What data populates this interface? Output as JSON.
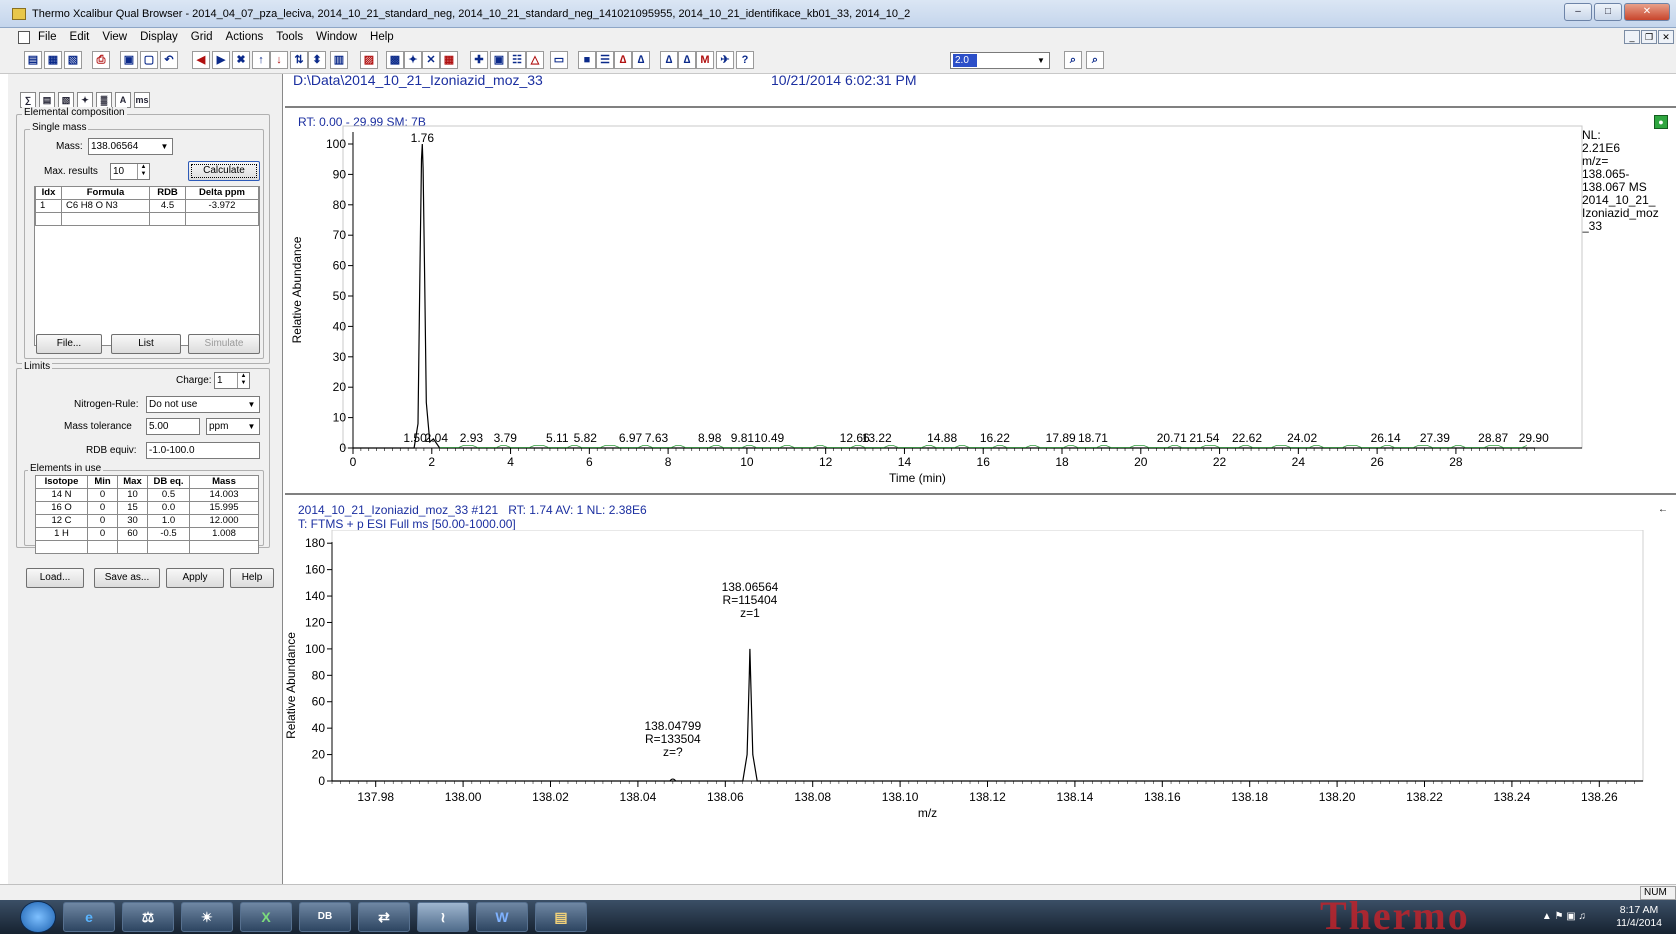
{
  "window": {
    "title": "Thermo Xcalibur Qual Browser - 2014_04_07_pza_leciva, 2014_10_21_standard_neg, 2014_10_21_standard_neg_141021095955, 2014_10_21_identifikace_kb01_33, 2014_10_2"
  },
  "menu": [
    "File",
    "Edit",
    "View",
    "Display",
    "Grid",
    "Actions",
    "Tools",
    "Window",
    "Help"
  ],
  "toolbar": {
    "zoom_value": "2.0"
  },
  "left": {
    "icons": [
      "calc-icon",
      "doc-icon",
      "spectrum-icon",
      "atom-icon",
      "chart-icon",
      "letter-a-icon",
      "ms-icon"
    ],
    "elemental_composition": "Elemental composition",
    "single_mass": "Single mass",
    "mass_label": "Mass:",
    "mass_value": "138.06564",
    "max_results_label": "Max. results",
    "max_results_value": "10",
    "calculate": "Calculate",
    "results_headers": [
      "Idx",
      "Formula",
      "RDB",
      "Delta ppm"
    ],
    "results_rows": [
      [
        "1",
        "C6 H8 O N3",
        "4.5",
        "-3.972"
      ]
    ],
    "file_btn": "File...",
    "list_btn": "List",
    "simulate_btn": "Simulate",
    "limits": "Limits",
    "charge_label": "Charge:",
    "charge_value": "1",
    "nitrogen_label": "Nitrogen-Rule:",
    "nitrogen_value": "Do not use",
    "mass_tol_label": "Mass tolerance",
    "mass_tol_value": "5.00",
    "mass_tol_unit": "ppm",
    "rdb_label": "RDB equiv:",
    "rdb_value": "-1.0-100.0",
    "elements_in_use": "Elements in use",
    "elements_headers": [
      "Isotope",
      "Min",
      "Max",
      "DB eq.",
      "Mass"
    ],
    "elements_rows": [
      [
        "14 N",
        "0",
        "10",
        "0.5",
        "14.003"
      ],
      [
        "16 O",
        "0",
        "15",
        "0.0",
        "15.995"
      ],
      [
        "12 C",
        "0",
        "30",
        "1.0",
        "12.000"
      ],
      [
        "1 H",
        "0",
        "60",
        "-0.5",
        "1.008"
      ]
    ],
    "load_btn": "Load...",
    "saveas_btn": "Save as...",
    "apply_btn": "Apply",
    "help_btn": "Help"
  },
  "header": {
    "path": "D:\\Data\\2014_10_21_Izoniazid_moz_33",
    "datetime": "10/21/2014 6:02:31 PM"
  },
  "chrom": {
    "info": "RT: 0.00 - 29.99   SM: 7B",
    "ylabel": "Relative Abundance",
    "xlabel": "Time (min)",
    "side": [
      "NL:",
      "2.21E6",
      "m/z=",
      "138.065-",
      "138.067  MS",
      "2014_10_21_",
      "Izoniazid_moz",
      "_33"
    ]
  },
  "spec": {
    "info1_name": "2014_10_21_Izoniazid_moz_33 #121",
    "info1_rest": "RT: 1.74   AV: 1   NL: 2.38E6",
    "info2": "T: FTMS + p ESI Full ms [50.00-1000.00]",
    "ylabel": "Relative Abundance",
    "xlabel": "m/z"
  },
  "chart_data": [
    {
      "type": "line",
      "title": "RT: 0.00 - 29.99   SM: 7B",
      "xlabel": "Time (min)",
      "ylabel": "Relative Abundance",
      "xlim": [
        0,
        30
      ],
      "ylim": [
        0,
        100
      ],
      "xticks": [
        0,
        2,
        4,
        6,
        8,
        10,
        12,
        14,
        16,
        18,
        20,
        22,
        24,
        26,
        28
      ],
      "yticks": [
        0,
        10,
        20,
        30,
        40,
        50,
        60,
        70,
        80,
        90,
        100
      ],
      "peak_labels": [
        {
          "x": 1.5,
          "label": "1.50"
        },
        {
          "x": 1.76,
          "label": "1.76",
          "y": 100
        },
        {
          "x": 2.04,
          "label": "2.04"
        },
        {
          "x": 2.93,
          "label": "2.93"
        },
        {
          "x": 3.79,
          "label": "3.79"
        },
        {
          "x": 5.11,
          "label": "5.11"
        },
        {
          "x": 5.82,
          "label": "5.82"
        },
        {
          "x": 6.97,
          "label": "6.97"
        },
        {
          "x": 7.63,
          "label": "7.63"
        },
        {
          "x": 8.98,
          "label": "8.98"
        },
        {
          "x": 9.81,
          "label": "9.81"
        },
        {
          "x": 10.49,
          "label": "10.49"
        },
        {
          "x": 12.66,
          "label": "12.66"
        },
        {
          "x": 13.22,
          "label": "13.22"
        },
        {
          "x": 14.88,
          "label": "14.88"
        },
        {
          "x": 16.22,
          "label": "16.22"
        },
        {
          "x": 17.89,
          "label": "17.89"
        },
        {
          "x": 18.71,
          "label": "18.71"
        },
        {
          "x": 20.71,
          "label": "20.71"
        },
        {
          "x": 21.54,
          "label": "21.54"
        },
        {
          "x": 22.62,
          "label": "22.62"
        },
        {
          "x": 24.02,
          "label": "24.02"
        },
        {
          "x": 26.14,
          "label": "26.14"
        },
        {
          "x": 27.39,
          "label": "27.39"
        },
        {
          "x": 28.87,
          "label": "28.87"
        },
        {
          "x": 29.9,
          "label": "29.90"
        }
      ],
      "series": [
        {
          "x": [
            0,
            1.55,
            1.65,
            1.7,
            1.74,
            1.76,
            1.78,
            1.82,
            1.86,
            1.95,
            2.04,
            2.2,
            30
          ],
          "y": [
            0,
            0,
            8,
            60,
            95,
            100,
            92,
            55,
            15,
            2,
            3,
            0,
            0
          ]
        }
      ]
    },
    {
      "type": "line",
      "title": "2014_10_21_Izoniazid_moz_33 #121   RT: 1.74   AV: 1   NL: 2.38E6",
      "xlabel": "m/z",
      "ylabel": "Relative Abundance",
      "xlim": [
        137.97,
        138.27
      ],
      "ylim": [
        0,
        190
      ],
      "xticks": [
        137.98,
        138.0,
        138.02,
        138.04,
        138.06,
        138.08,
        138.1,
        138.12,
        138.14,
        138.16,
        138.18,
        138.2,
        138.22,
        138.24,
        138.26
      ],
      "yticks": [
        0,
        20,
        40,
        60,
        80,
        100,
        120,
        140,
        160,
        180
      ],
      "annotations": [
        {
          "x": 138.06564,
          "lines": [
            "138.06564",
            "R=115404",
            "z=1"
          ]
        },
        {
          "x": 138.04799,
          "lines": [
            "138.04799",
            "R=133504",
            "z=?"
          ]
        }
      ],
      "series": [
        {
          "x": [
            137.97,
            138.064,
            138.065,
            138.0655,
            138.06564,
            138.0658,
            138.0663,
            138.0673,
            138.27
          ],
          "y": [
            0,
            0,
            20,
            80,
            100,
            80,
            20,
            0,
            0
          ]
        }
      ]
    }
  ],
  "status": {
    "num": "NUM"
  },
  "taskbar": {
    "time": "8:17 AM",
    "date": "11/4/2014",
    "brand": "Thermo"
  }
}
